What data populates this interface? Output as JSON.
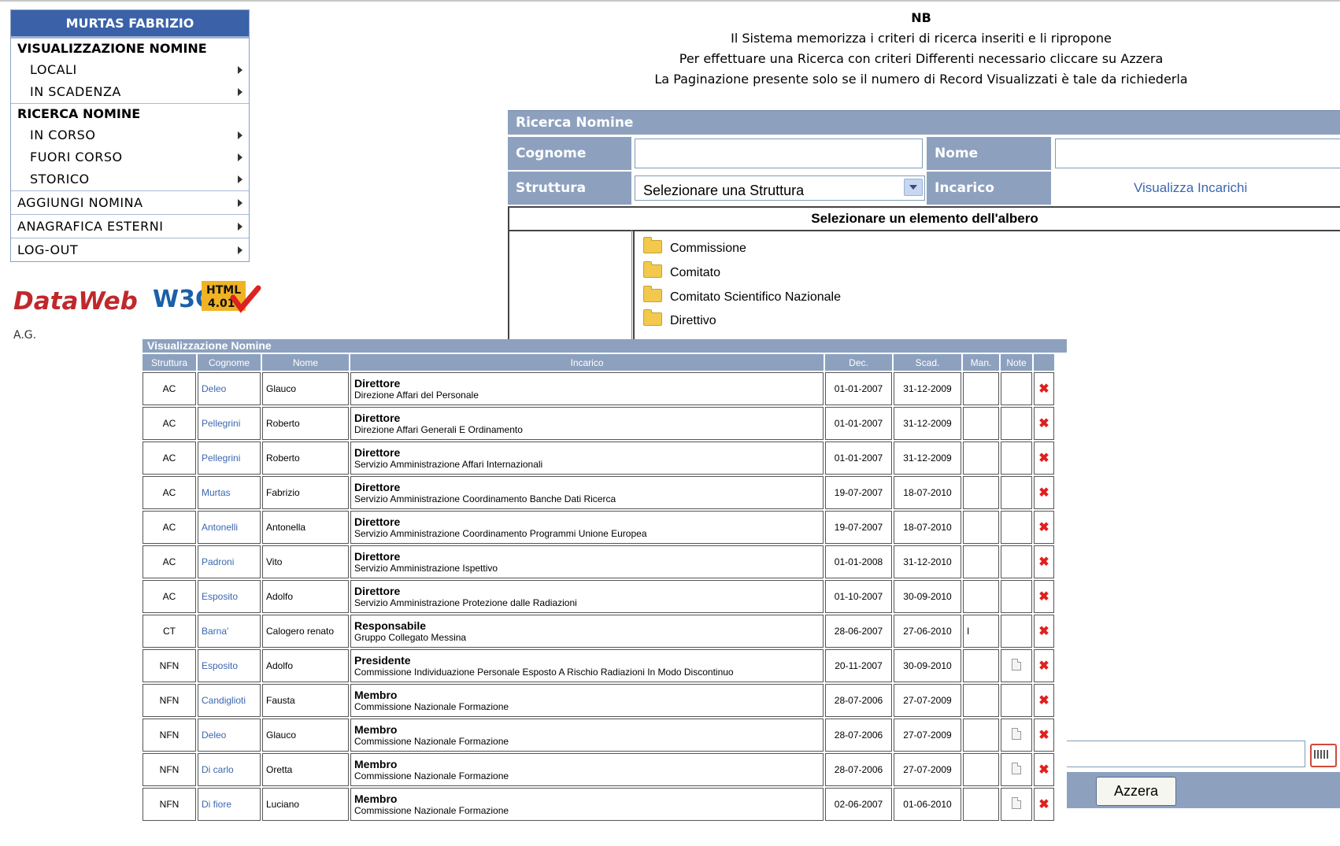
{
  "sidebar": {
    "user": "MURTAS FABRIZIO",
    "sections": [
      {
        "title": "VISUALIZZAZIONE NOMINE",
        "items": [
          "LOCALI",
          "IN SCADENZA"
        ]
      },
      {
        "title": "RICERCA NOMINE",
        "items": [
          "IN CORSO",
          "FUORI CORSO",
          "STORICO"
        ]
      }
    ],
    "top_items": [
      "AGGIUNGI NOMINA",
      "ANAGRAFICA ESTERNI",
      "LOG-OUT"
    ]
  },
  "logos": {
    "dataweb": "DataWeb",
    "w3c": "W3C",
    "html_label": "HTML",
    "html_version": "4.01"
  },
  "footer_initials": "A.G.",
  "notes": {
    "title": "NB",
    "lines": [
      "Il Sistema memorizza i criteri di ricerca inseriti e li ripropone",
      "Per effettuare una Ricerca con criteri Differenti necessario cliccare su Azzera",
      "La Paginazione presente solo se il numero di Record Visualizzati è tale da richiederla"
    ]
  },
  "search": {
    "title": "Ricerca Nomine",
    "cognome_label": "Cognome",
    "cognome_value": "",
    "nome_label": "Nome",
    "nome_value": "",
    "struttura_label": "Struttura",
    "struttura_selected": "Selezionare una Struttura",
    "incarico_label": "Incarico",
    "incarico_link": "Visualizza Incarichi",
    "tree_header": "Selezionare un elemento dell'albero",
    "tree_nodes": [
      "Commissione",
      "Comitato",
      "Comitato Scientifico Nazionale",
      "Direttivo"
    ],
    "reset_label": "Azzera"
  },
  "results": {
    "title": "Visualizzazione Nomine",
    "columns": [
      "Struttura",
      "Cognome",
      "Nome",
      "Incarico",
      "Dec.",
      "Scad.",
      "Man.",
      "Note"
    ],
    "rows": [
      {
        "struttura": "AC",
        "cognome": "Deleo",
        "nome": "Glauco",
        "ruolo": "Direttore",
        "struttura_inc": "Direzione Affari del Personale",
        "dec": "01-01-2007",
        "scad": "31-12-2009",
        "man": "",
        "note": false
      },
      {
        "struttura": "AC",
        "cognome": "Pellegrini",
        "nome": "Roberto",
        "ruolo": "Direttore",
        "struttura_inc": "Direzione Affari Generali E Ordinamento",
        "dec": "01-01-2007",
        "scad": "31-12-2009",
        "man": "",
        "note": false
      },
      {
        "struttura": "AC",
        "cognome": "Pellegrini",
        "nome": "Roberto",
        "ruolo": "Direttore",
        "struttura_inc": "Servizio Amministrazione Affari Internazionali",
        "dec": "01-01-2007",
        "scad": "31-12-2009",
        "man": "",
        "note": false
      },
      {
        "struttura": "AC",
        "cognome": "Murtas",
        "nome": "Fabrizio",
        "ruolo": "Direttore",
        "struttura_inc": "Servizio Amministrazione Coordinamento Banche Dati Ricerca",
        "dec": "19-07-2007",
        "scad": "18-07-2010",
        "man": "",
        "note": false
      },
      {
        "struttura": "AC",
        "cognome": "Antonelli",
        "nome": "Antonella",
        "ruolo": "Direttore",
        "struttura_inc": "Servizio Amministrazione Coordinamento Programmi Unione Europea",
        "dec": "19-07-2007",
        "scad": "18-07-2010",
        "man": "",
        "note": false
      },
      {
        "struttura": "AC",
        "cognome": "Padroni",
        "nome": "Vito",
        "ruolo": "Direttore",
        "struttura_inc": "Servizio Amministrazione Ispettivo",
        "dec": "01-01-2008",
        "scad": "31-12-2010",
        "man": "",
        "note": false
      },
      {
        "struttura": "AC",
        "cognome": "Esposito",
        "nome": "Adolfo",
        "ruolo": "Direttore",
        "struttura_inc": "Servizio Amministrazione Protezione dalle Radiazioni",
        "dec": "01-10-2007",
        "scad": "30-09-2010",
        "man": "",
        "note": false
      },
      {
        "struttura": "CT",
        "cognome": "Barna'",
        "nome": "Calogero renato",
        "ruolo": "Responsabile",
        "struttura_inc": "Gruppo Collegato Messina",
        "dec": "28-06-2007",
        "scad": "27-06-2010",
        "man": "I",
        "note": false
      },
      {
        "struttura": "NFN",
        "cognome": "Esposito",
        "nome": "Adolfo",
        "ruolo": "Presidente",
        "struttura_inc": "Commissione Individuazione Personale Esposto A Rischio Radiazioni In Modo Discontinuo",
        "dec": "20-11-2007",
        "scad": "30-09-2010",
        "man": "",
        "note": true
      },
      {
        "struttura": "NFN",
        "cognome": "Candiglioti",
        "nome": "Fausta",
        "ruolo": "Membro",
        "struttura_inc": "Commissione Nazionale Formazione",
        "dec": "28-07-2006",
        "scad": "27-07-2009",
        "man": "",
        "note": false
      },
      {
        "struttura": "NFN",
        "cognome": "Deleo",
        "nome": "Glauco",
        "ruolo": "Membro",
        "struttura_inc": "Commissione Nazionale Formazione",
        "dec": "28-07-2006",
        "scad": "27-07-2009",
        "man": "",
        "note": true
      },
      {
        "struttura": "NFN",
        "cognome": "Di carlo",
        "nome": "Oretta",
        "ruolo": "Membro",
        "struttura_inc": "Commissione Nazionale Formazione",
        "dec": "28-07-2006",
        "scad": "27-07-2009",
        "man": "",
        "note": true
      },
      {
        "struttura": "NFN",
        "cognome": "Di fiore",
        "nome": "Luciano",
        "ruolo": "Membro",
        "struttura_inc": "Commissione Nazionale Formazione",
        "dec": "02-06-2007",
        "scad": "01-06-2010",
        "man": "",
        "note": true
      }
    ]
  },
  "colors": {
    "brand_blue": "#3b62a8",
    "panel_blue": "#8da1bf",
    "link_blue": "#3b67b0",
    "delete_red": "#e02020",
    "dataweb_red": "#c0282b"
  },
  "icons": {
    "menu_arrow": "arrow-right-icon",
    "tree_folder": "folder-icon",
    "delete": "delete-x-icon",
    "note": "note-icon",
    "calendar": "calendar-icon"
  }
}
